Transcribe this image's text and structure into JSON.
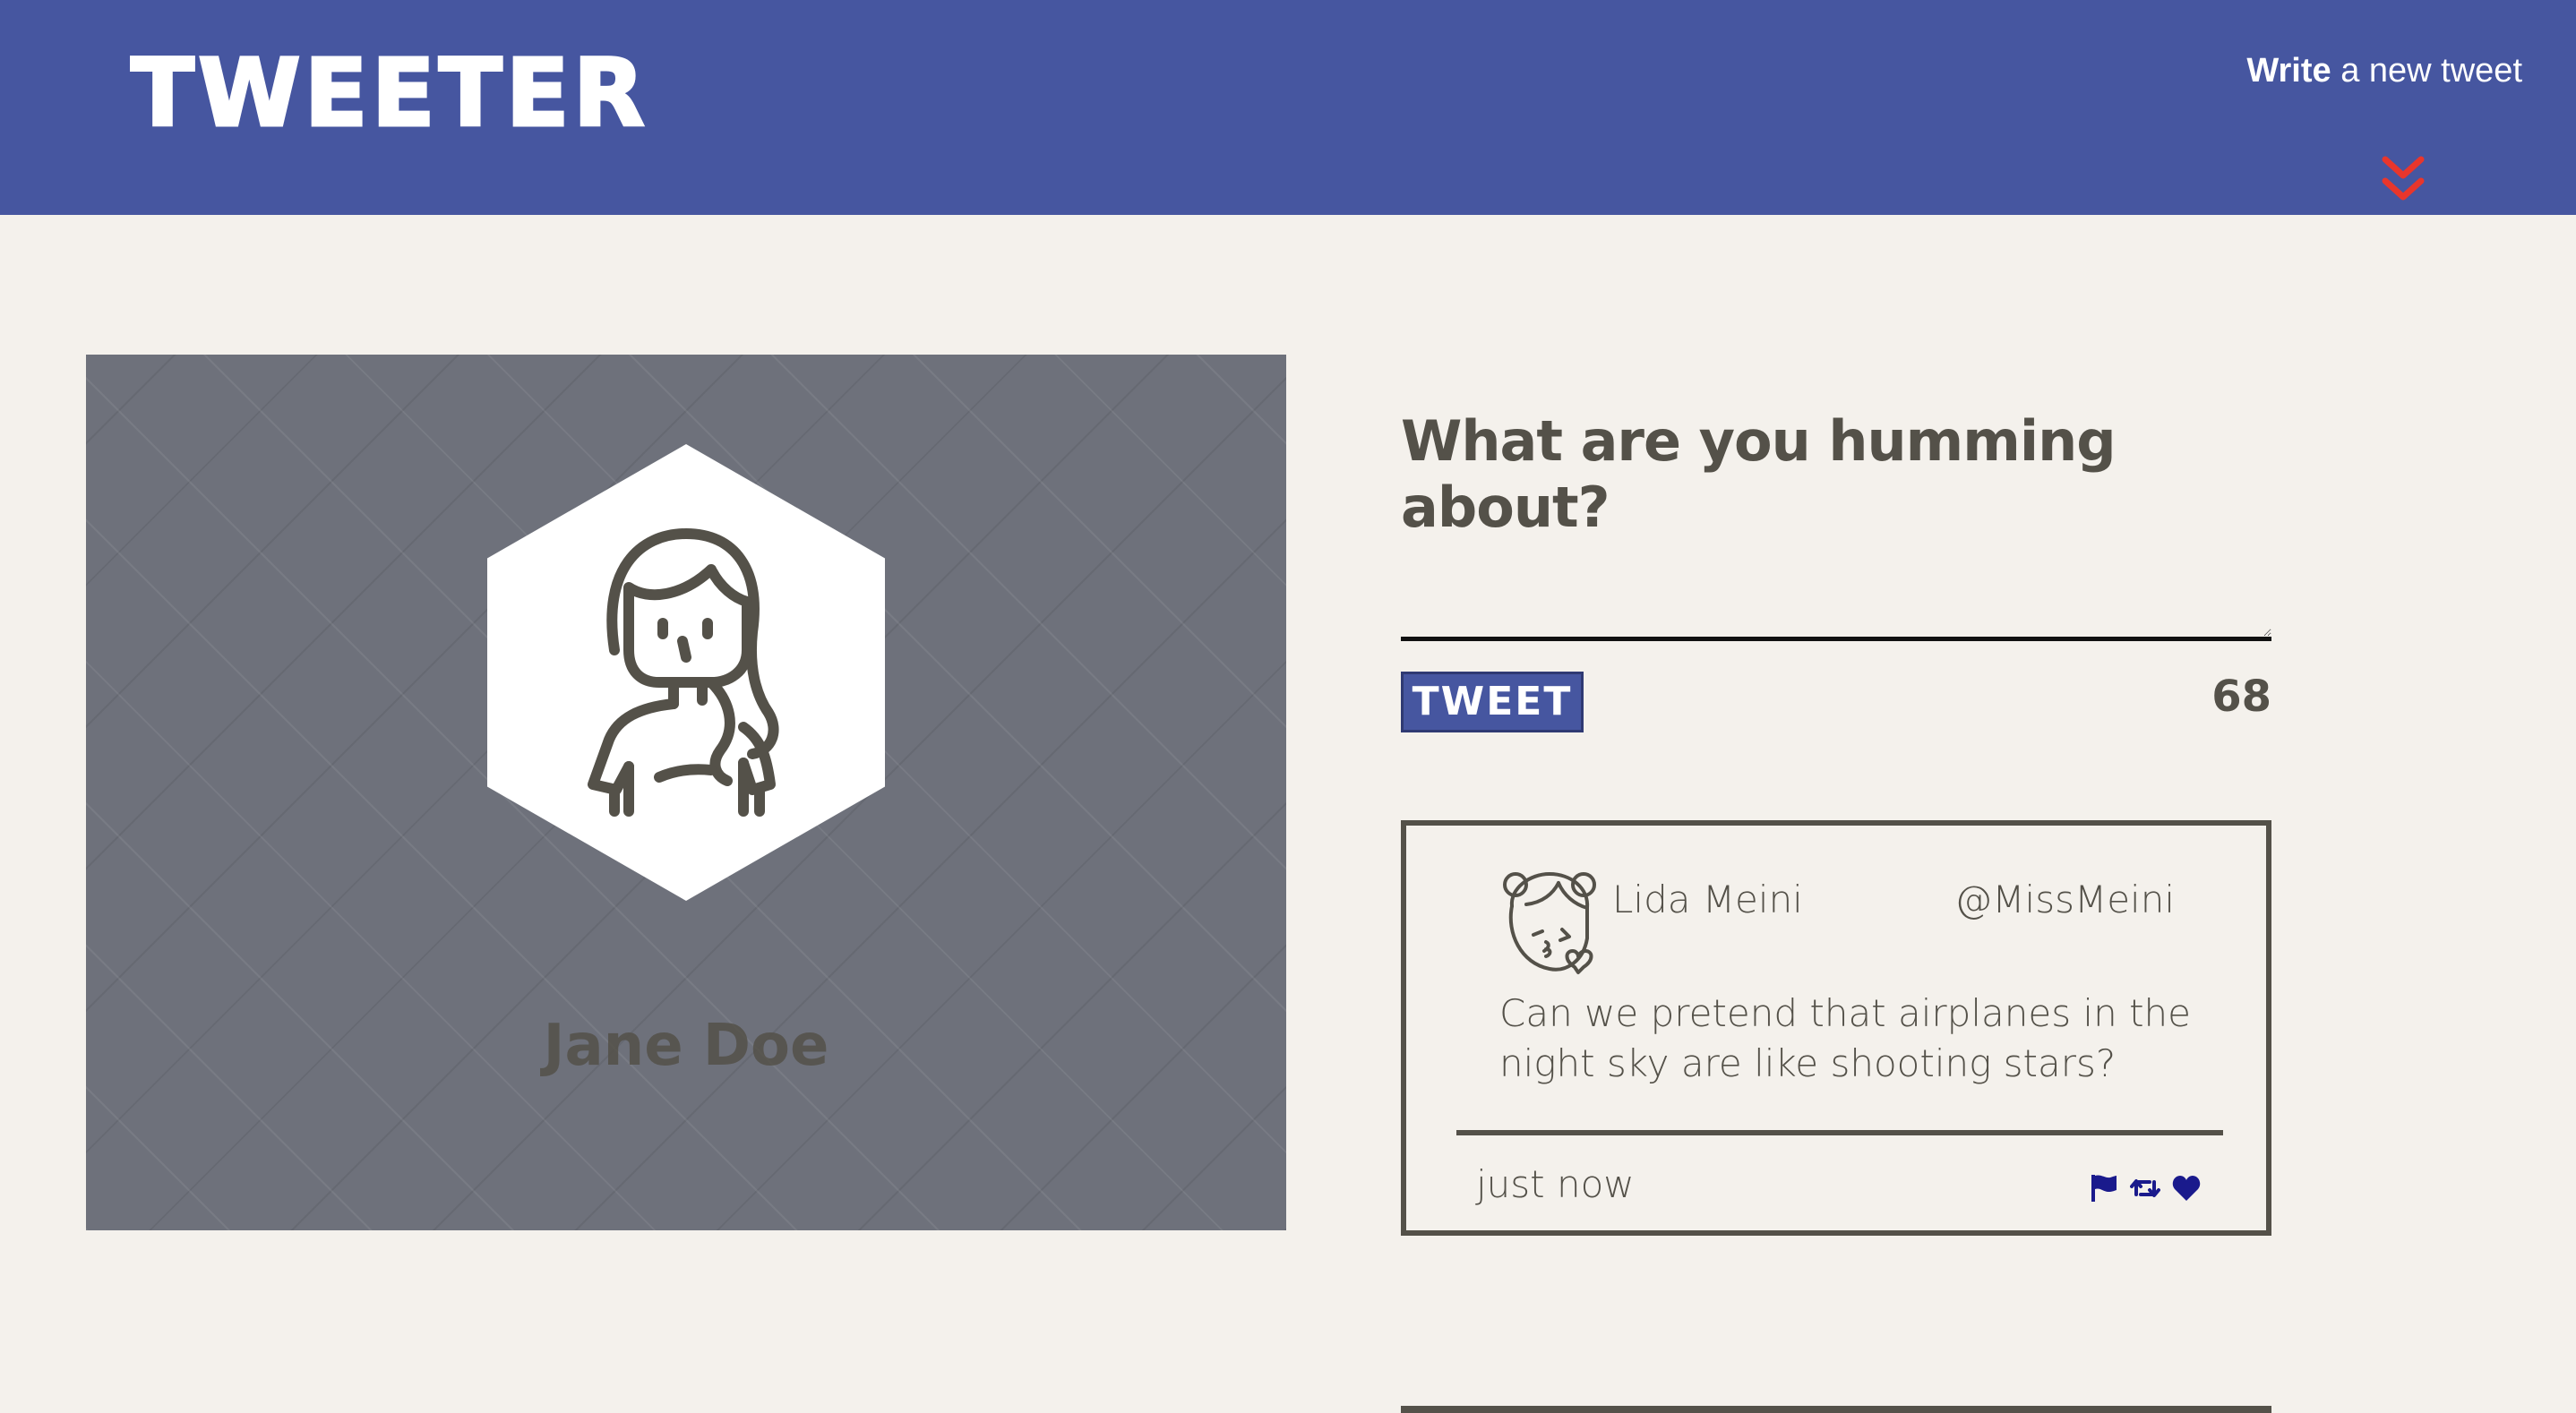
{
  "nav": {
    "brand": "TWEETER",
    "compose_bold": "Write",
    "compose_rest": " a new tweet",
    "chevron_icon": "double-chevron-down-icon",
    "colors": {
      "background": "#4656a0",
      "chevron": "#e8362c"
    }
  },
  "profile": {
    "name": "Jane Doe",
    "avatar_icon": "woman-avatar-icon"
  },
  "composer": {
    "title": "What are you humming about?",
    "placeholder": "",
    "button_label": "TWEET",
    "char_count": "68"
  },
  "tweets": [
    {
      "user_name": "Lida Meini",
      "handle": "@MissMeini",
      "text": "Can we pretend that airplanes in the night sky are like shooting stars?",
      "time": "just now",
      "avatar_icon": "girl-kiss-avatar-icon",
      "actions": [
        "flag-icon",
        "retweet-icon",
        "heart-icon"
      ],
      "action_color": "#1a1a8c"
    }
  ],
  "colors": {
    "page_background": "#f4f1ec",
    "text": "#545149",
    "accent": "#4656a0"
  }
}
